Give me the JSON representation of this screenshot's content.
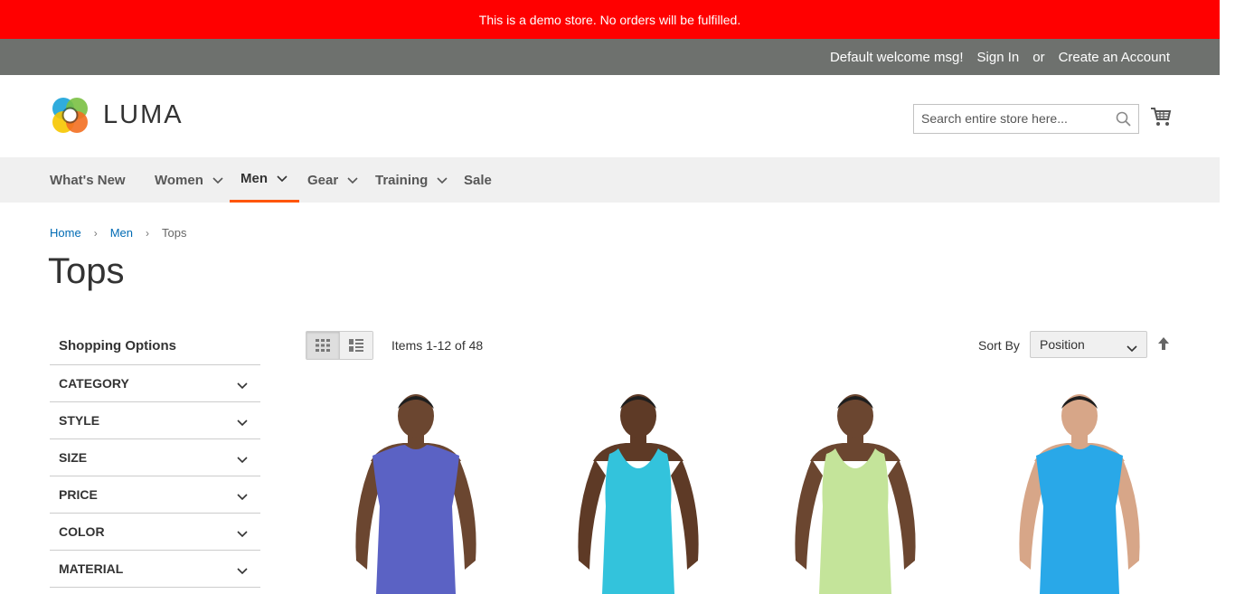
{
  "demo_notice": "This is a demo store. No orders will be fulfilled.",
  "header_links": {
    "welcome": "Default welcome msg!",
    "sign_in": "Sign In",
    "or": "or",
    "create_account": "Create an Account"
  },
  "logo": {
    "text": "LUMA"
  },
  "search": {
    "placeholder": "Search entire store here...",
    "value": ""
  },
  "nav": {
    "items": [
      {
        "label": "What's New",
        "has_dropdown": false
      },
      {
        "label": "Women",
        "has_dropdown": true
      },
      {
        "label": "Men",
        "has_dropdown": true,
        "active": true
      },
      {
        "label": "Gear",
        "has_dropdown": true
      },
      {
        "label": "Training",
        "has_dropdown": true
      },
      {
        "label": "Sale",
        "has_dropdown": false
      }
    ]
  },
  "breadcrumbs": [
    {
      "label": "Home",
      "link": true
    },
    {
      "label": "Men",
      "link": true
    },
    {
      "label": "Tops",
      "link": false
    }
  ],
  "page_title": "Tops",
  "sidebar": {
    "title": "Shopping Options",
    "filters": [
      "CATEGORY",
      "STYLE",
      "SIZE",
      "PRICE",
      "COLOR",
      "MATERIAL"
    ]
  },
  "toolbar": {
    "amount": "Items 1-12 of 48",
    "sort_label": "Sort By",
    "sort_value": "Position"
  },
  "products": [
    {
      "shirt_color": "#5b62c4",
      "skin": "#6b4630",
      "type": "sleeveless"
    },
    {
      "shirt_color": "#33c3dc",
      "skin": "#5e3a26",
      "type": "tank"
    },
    {
      "shirt_color": "#c4e49a",
      "skin": "#6b4630",
      "type": "tank"
    },
    {
      "shirt_color": "#29a8e8",
      "skin": "#d7a688",
      "type": "sleeveless"
    }
  ],
  "colors": {
    "demo_bar": "#ff0000",
    "top_bar": "#6e716e",
    "nav_bg": "#f0f0f0",
    "accent": "#ff5501",
    "link": "#006bb4"
  }
}
